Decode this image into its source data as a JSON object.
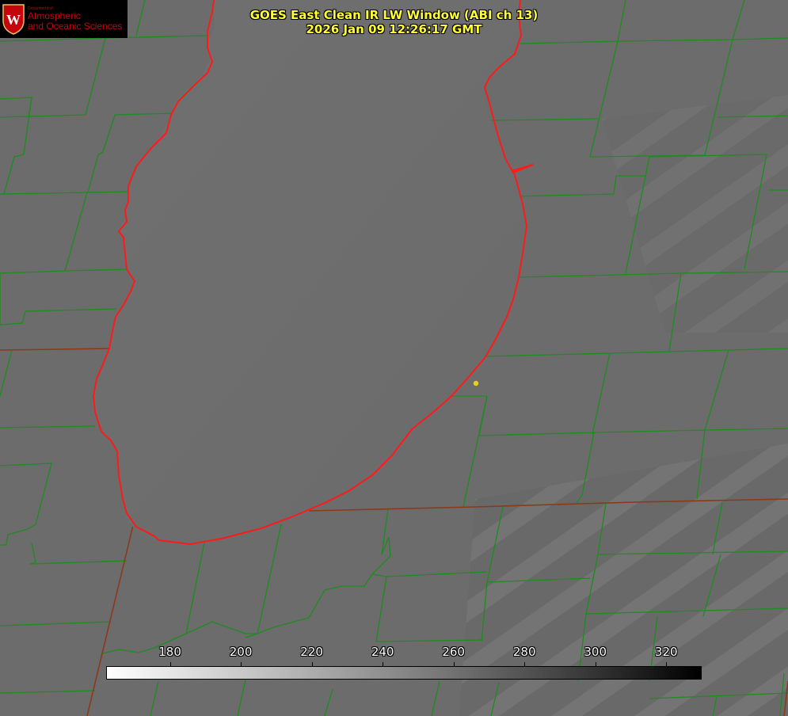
{
  "title": {
    "line1": "GOES East Clean IR LW Window (ABI ch 13)",
    "line2": "2026 Jan 09 12:26:17 GMT"
  },
  "logo": {
    "small_text": "Department of",
    "line1": "Atmospheric",
    "line2": "and Oceanic Sciences",
    "crest_letter": "W"
  },
  "colorbar": {
    "ticks": [
      "180",
      "200",
      "220",
      "240",
      "260",
      "280",
      "300",
      "320"
    ],
    "tick_values": [
      180,
      200,
      220,
      240,
      260,
      280,
      300,
      320
    ],
    "min": 162,
    "max": 330
  },
  "colors": {
    "background_gray": "#6f6f6f",
    "county_lines": "#1e8c1e",
    "lake_outline": "#ff1a1a",
    "title_text": "#ffff33",
    "logo_red": "#c5050c",
    "marker": "#e6d21a"
  },
  "marker": {
    "label": "station-dot"
  }
}
